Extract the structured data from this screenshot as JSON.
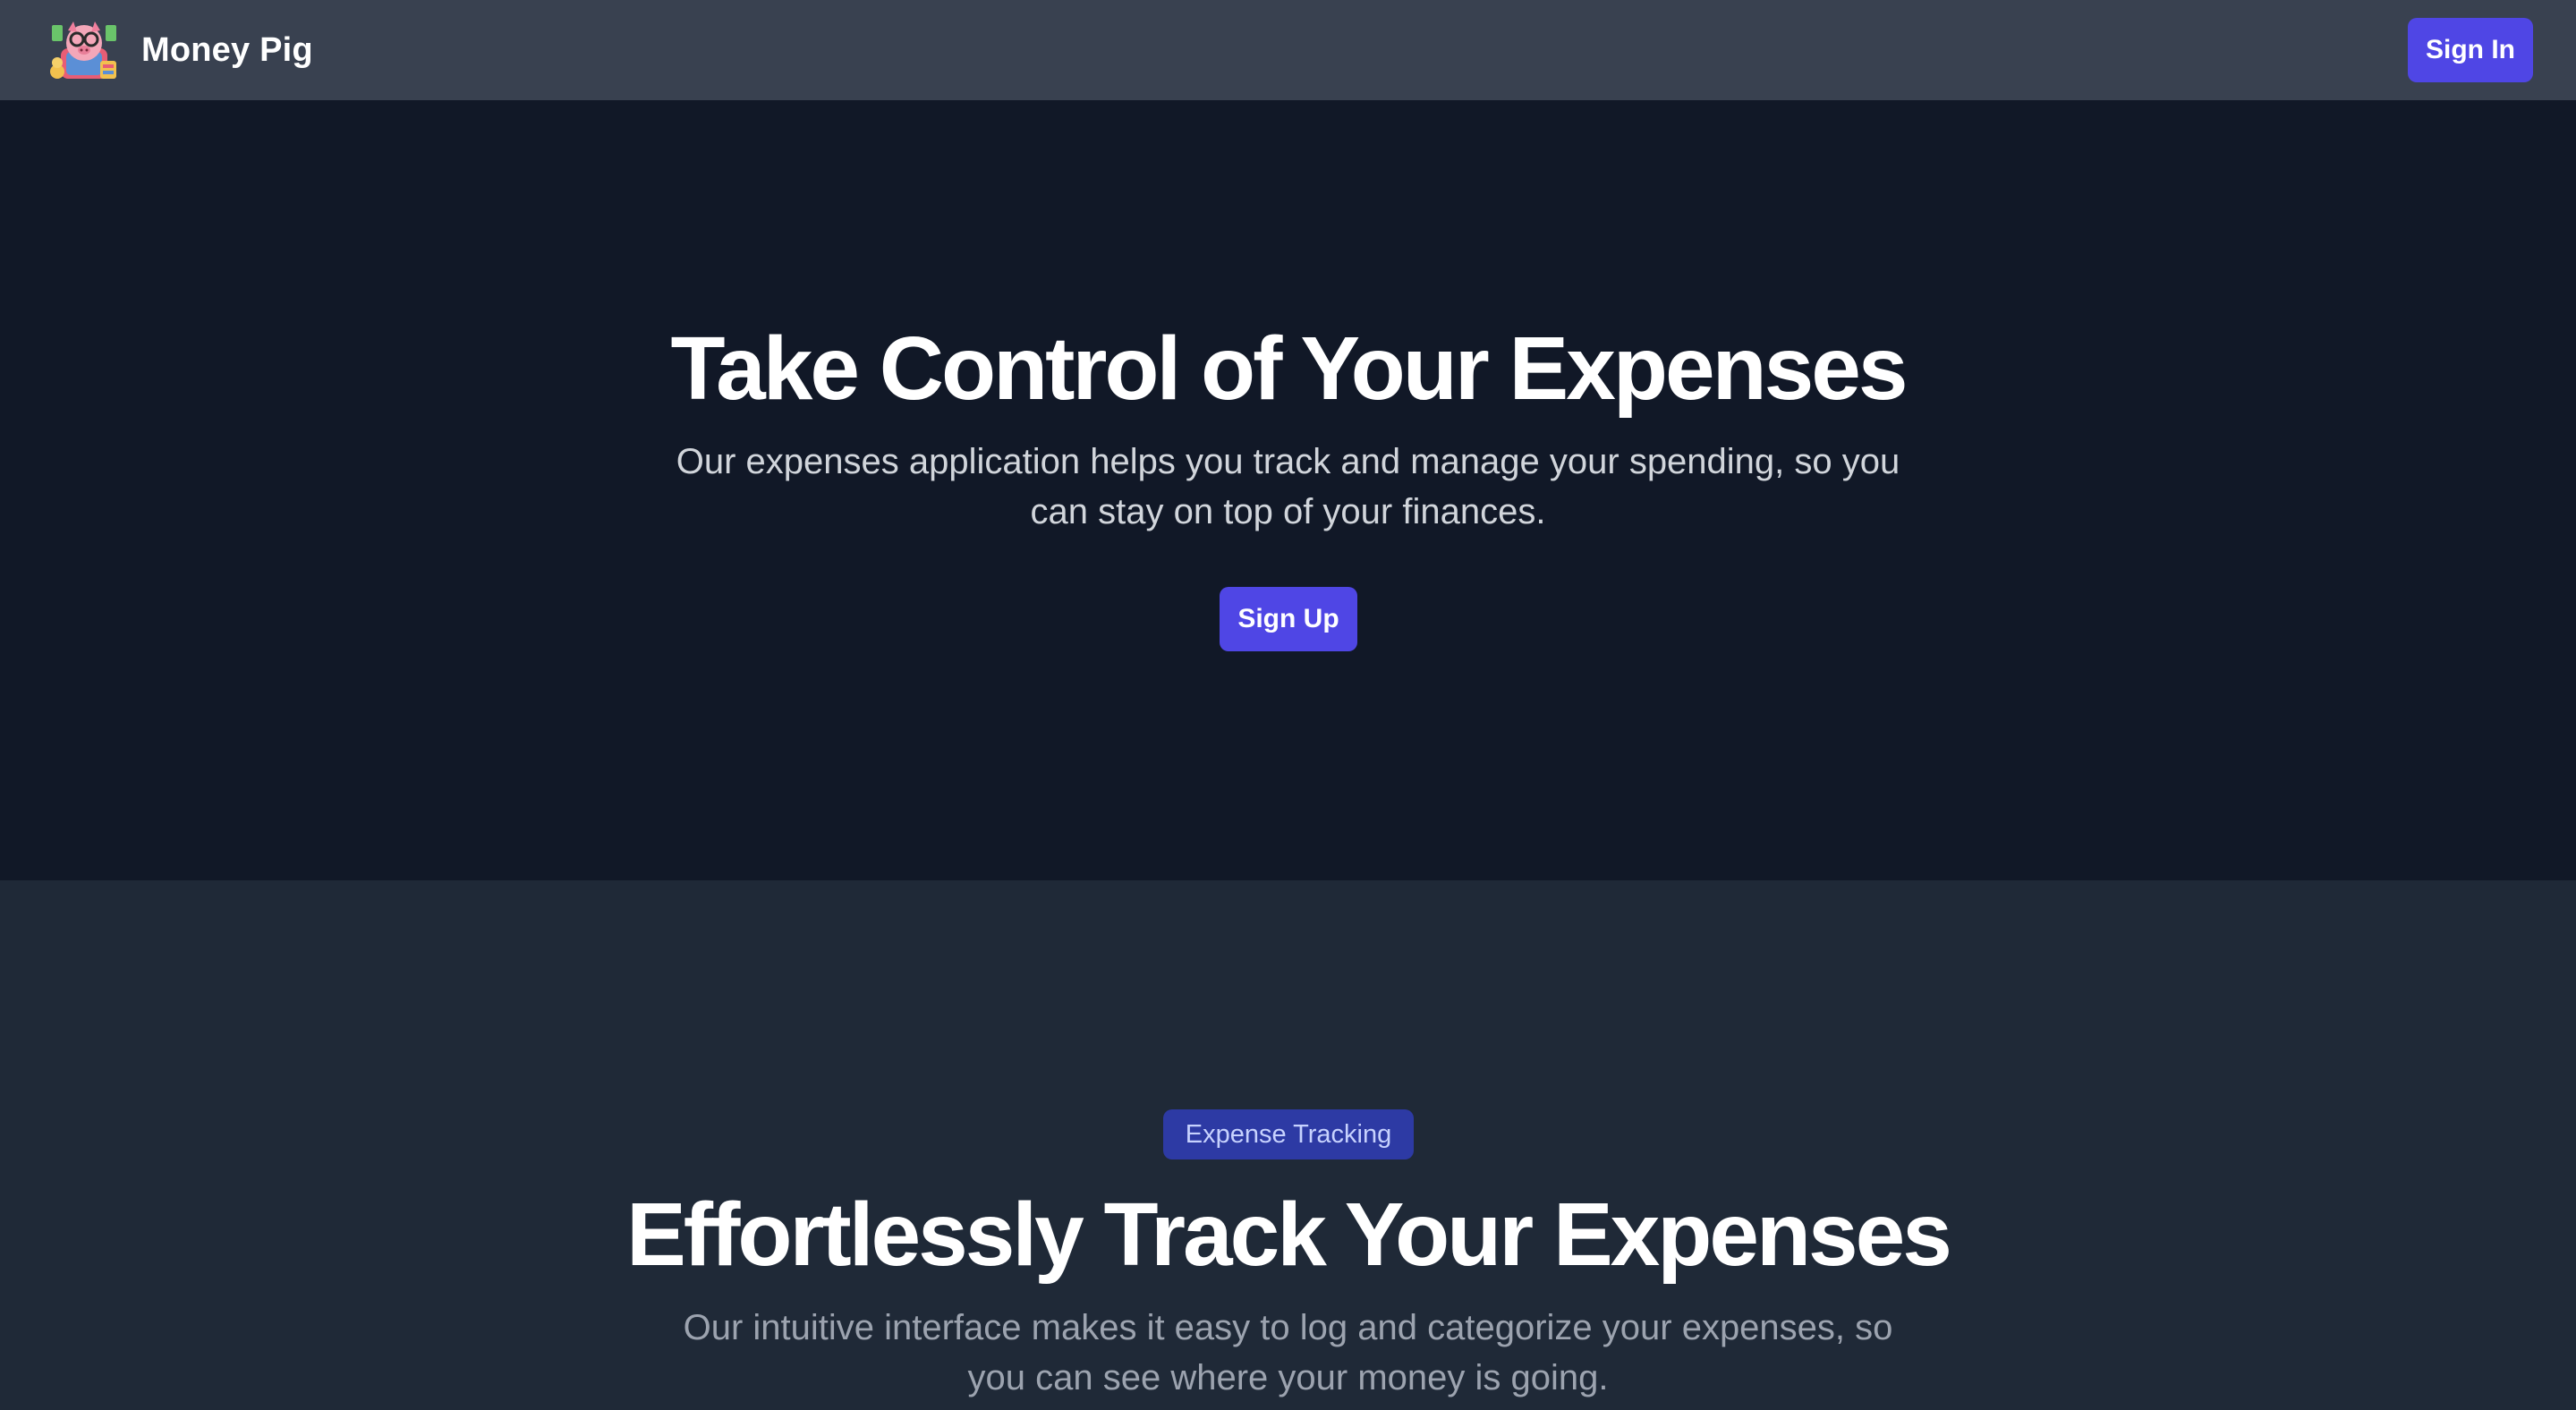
{
  "header": {
    "brand_name": "Money Pig",
    "logo_icon": "pig-mascot-logo-icon",
    "signin_label": "Sign In"
  },
  "hero": {
    "title": "Take Control of Your Expenses",
    "subtitle": "Our expenses application helps you track and manage your spending, so you can stay on top of your finances.",
    "signup_label": "Sign Up"
  },
  "feature": {
    "badge": "Expense Tracking",
    "title": "Effortlessly Track Your Expenses",
    "subtitle": "Our intuitive interface makes it easy to log and categorize your expenses, so you can see where your money is going."
  },
  "colors": {
    "header_bg": "#394150",
    "hero_bg": "#111827",
    "feature_bg": "#1f2937",
    "accent": "#4f46e5",
    "badge_bg": "#2d3aa4"
  }
}
